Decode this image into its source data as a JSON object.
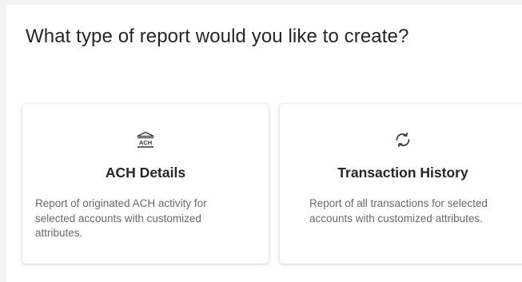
{
  "page": {
    "title": "What type of report would you like to create?"
  },
  "cards": [
    {
      "icon": "bank-icon",
      "icon_text": "ACH",
      "title": "ACH Details",
      "description": "Report of originated ACH activity for selected accounts with customized attributes."
    },
    {
      "icon": "refresh-icon",
      "title": "Transaction History",
      "description": "Report of all transactions for selected accounts with customized attributes."
    }
  ],
  "colors": {
    "background": "#f3f3f3",
    "panel": "#ffffff",
    "title_text": "#262626",
    "description_text": "#6a6a6a"
  }
}
